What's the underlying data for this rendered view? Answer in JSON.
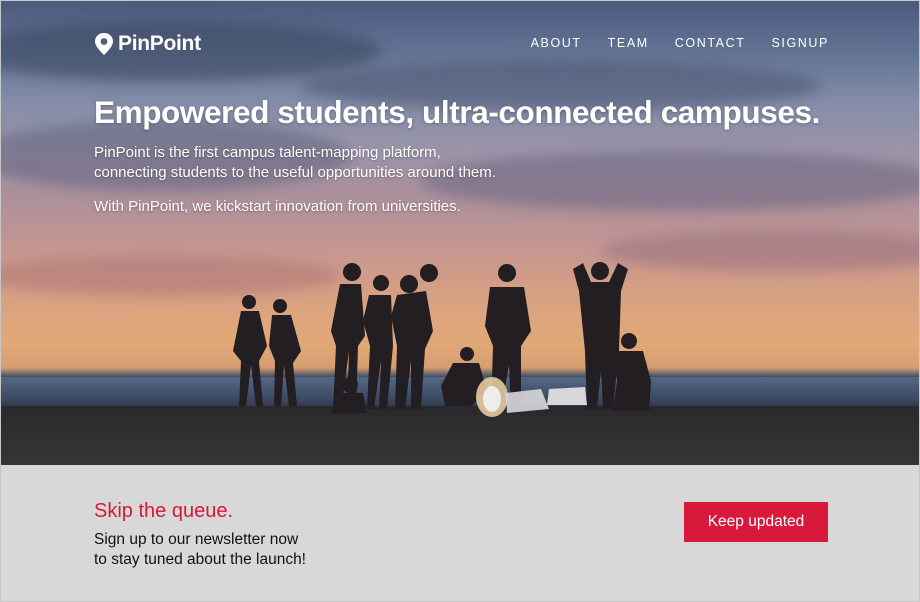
{
  "brand": {
    "name": "PinPoint",
    "icon": "map-pin-icon"
  },
  "nav": {
    "items": [
      {
        "label": "ABOUT"
      },
      {
        "label": "TEAM"
      },
      {
        "label": "CONTACT"
      },
      {
        "label": "SIGNUP"
      }
    ]
  },
  "hero": {
    "headline": "Empowered students, ultra-connected campuses.",
    "line1": "PinPoint is the first campus talent-mapping platform,",
    "line2": "connecting students to the useful opportunities around them.",
    "line3": "With PinPoint, we kickstart innovation from universities.",
    "image": "sunset beach campfire silhouettes photo"
  },
  "cta": {
    "title": "Skip the queue.",
    "line1": "Sign up to our newsletter now",
    "line2": "to stay tuned about the launch!",
    "button": "Keep updated"
  },
  "colors": {
    "accent": "#d8193c",
    "footer_bg": "#d8d8d8",
    "text_light": "#ffffff"
  }
}
